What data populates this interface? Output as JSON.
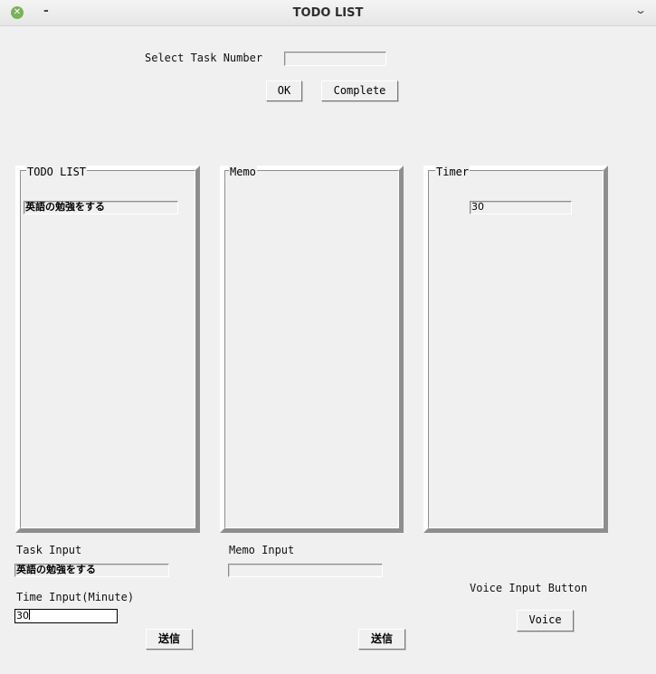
{
  "window": {
    "title": "TODO LIST",
    "close_icon": "close-icon",
    "minimize_label": "-",
    "menu_icon": "chevron-down-icon"
  },
  "select": {
    "label": "Select Task Number",
    "value": "",
    "ok_label": "OK",
    "complete_label": "Complete"
  },
  "frames": {
    "todo_title": "TODO LIST",
    "memo_title": "Memo",
    "timer_title": "Timer"
  },
  "todo_items": [
    "英語の勉強をする"
  ],
  "timer_items": [
    "30"
  ],
  "task_input": {
    "label": "Task Input",
    "value": "英語の勉強をする"
  },
  "time_input": {
    "label": "Time Input(Minute)",
    "value": "30"
  },
  "memo_input": {
    "label": "Memo Input",
    "value": ""
  },
  "send_label": "送信",
  "voice": {
    "label": "Voice Input Button",
    "button_label": "Voice"
  },
  "colors": {
    "window_bg": "#f0f0f0",
    "close_icon": "#78b35a"
  }
}
